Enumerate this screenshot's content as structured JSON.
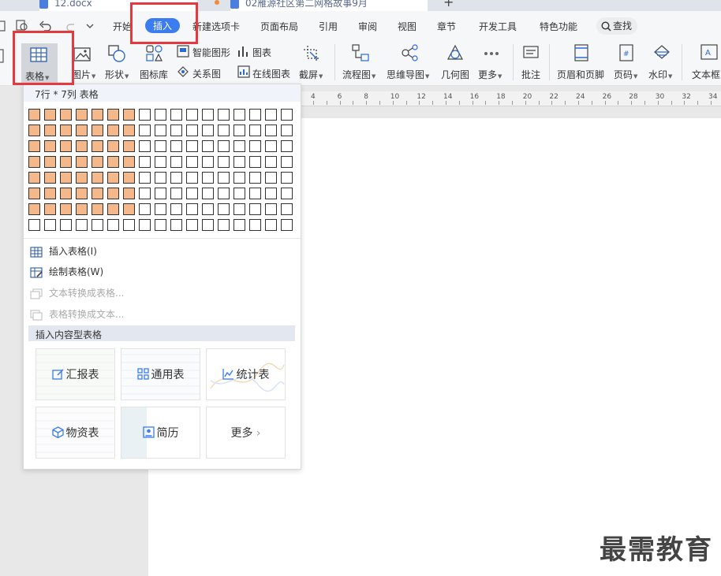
{
  "tabs": [
    {
      "label": "12.docx"
    },
    {
      "label": "02雁源社区第二网格故事9月"
    }
  ],
  "tab_add_label": "+",
  "menu": {
    "items": [
      "开始",
      "插入",
      "新建选项卡",
      "页面布局",
      "引用",
      "审阅",
      "视图",
      "章节",
      "开发工具",
      "特色功能"
    ],
    "active": "插入",
    "search_label": "查找"
  },
  "ribbon": {
    "table": "表格",
    "picture": "图片",
    "shape": "形状",
    "icon_lib": "图标库",
    "smart_shape": "智能图形",
    "chart": "图表",
    "relation": "关系图",
    "online_chart": "在线图表",
    "screenshot": "截屏",
    "flowchart": "流程图",
    "mindmap": "思维导图",
    "geometry": "几何图",
    "more": "更多",
    "comment": "批注",
    "header_footer": "页眉和页脚",
    "page_number": "页码",
    "watermark": "水印",
    "textbox": "文本框"
  },
  "ruler_ticks": [
    "4",
    "6",
    "8",
    "10",
    "12",
    "14",
    "16",
    "18",
    "20",
    "22",
    "24",
    "26",
    "28",
    "30",
    "32",
    "34"
  ],
  "dropdown": {
    "grid_header": "7行 * 7列 表格",
    "grid_rows": 8,
    "grid_cols": 17,
    "selected_rows": 7,
    "selected_cols": 7,
    "items": [
      {
        "label": "插入表格(I)",
        "enabled": true
      },
      {
        "label": "绘制表格(W)",
        "enabled": true
      },
      {
        "label": "文本转换成表格...",
        "enabled": false
      },
      {
        "label": "表格转换成文本...",
        "enabled": false
      }
    ],
    "section_title": "插入内容型表格",
    "templates": [
      {
        "label": "汇报表",
        "icon": "edit-icon"
      },
      {
        "label": "通用表",
        "icon": "grid-icon"
      },
      {
        "label": "统计表",
        "icon": "line-chart-icon"
      },
      {
        "label": "物资表",
        "icon": "cube-icon"
      },
      {
        "label": "简历",
        "icon": "id-card-icon"
      },
      {
        "label": "更多",
        "icon": "chevron-right-icon"
      }
    ]
  },
  "watermark_text": "最需教育",
  "colors": {
    "accent": "#3b7cf0",
    "grid_selected": "#f5b88b",
    "highlight_box": "#e5393f"
  }
}
